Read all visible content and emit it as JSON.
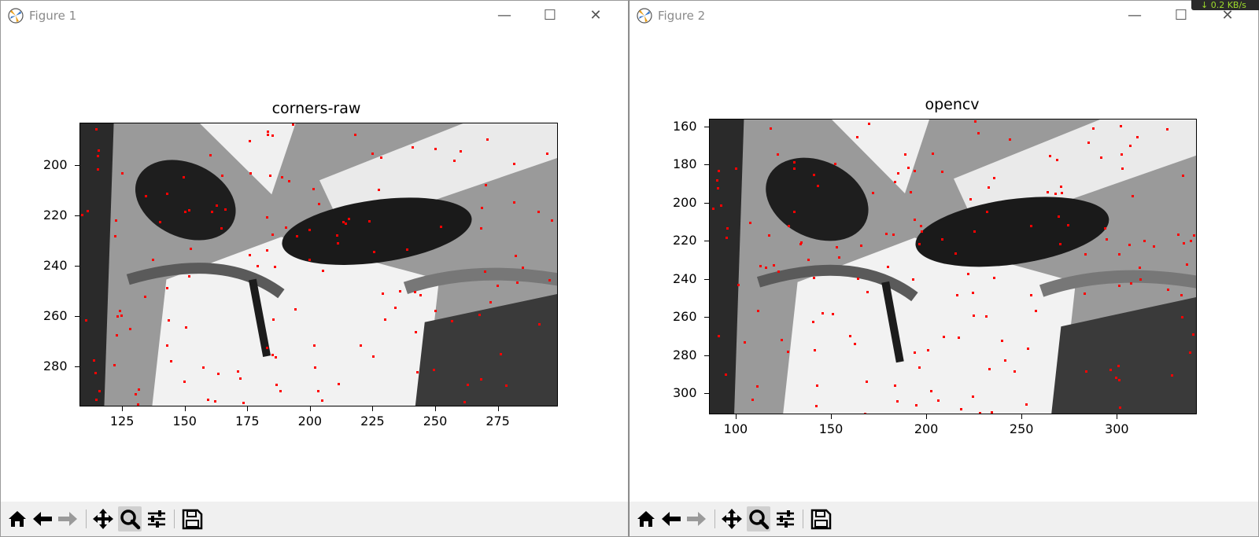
{
  "windows": [
    {
      "title": "Figure 1",
      "controls": {
        "minimize": "—",
        "maximize": "☐",
        "close": "✕"
      },
      "figure": {
        "title": "corners-raw",
        "chart_data": {
          "type": "heatmap",
          "title": "corners-raw",
          "x_ticks": [
            "125",
            "150",
            "175",
            "200",
            "225",
            "250",
            "275"
          ],
          "x_tick_values": [
            125,
            150,
            175,
            200,
            225,
            250,
            275
          ],
          "y_ticks": [
            "200",
            "220",
            "240",
            "260",
            "280"
          ],
          "y_tick_values": [
            200,
            220,
            240,
            260,
            280
          ],
          "xlim": [
            108,
            299
          ],
          "ylim": [
            296,
            183
          ],
          "image_content": "grayscale face/mask crop with red corner detection points"
        }
      }
    },
    {
      "title": "Figure 2",
      "controls": {
        "minimize": "—",
        "maximize": "☐",
        "close": "✕"
      },
      "figure": {
        "title": "opencv",
        "chart_data": {
          "type": "heatmap",
          "title": "opencv",
          "x_ticks": [
            "100",
            "150",
            "200",
            "250",
            "300"
          ],
          "x_tick_values": [
            100,
            150,
            200,
            250,
            300
          ],
          "y_ticks": [
            "160",
            "180",
            "200",
            "220",
            "240",
            "260",
            "280",
            "300"
          ],
          "y_tick_values": [
            160,
            180,
            200,
            220,
            240,
            260,
            280,
            300
          ],
          "xlim": [
            86,
            342
          ],
          "ylim": [
            311,
            156
          ],
          "image_content": "grayscale face/mask crop with red corner detection points"
        }
      }
    }
  ],
  "toolbar": {
    "buttons": [
      {
        "name": "home",
        "icon": "home-icon"
      },
      {
        "name": "back",
        "icon": "back-arrow-icon"
      },
      {
        "name": "forward",
        "icon": "forward-arrow-icon"
      },
      {
        "name": "pan",
        "icon": "move-icon"
      },
      {
        "name": "zoom",
        "icon": "magnifier-icon",
        "active": true
      },
      {
        "name": "configure",
        "icon": "sliders-icon"
      },
      {
        "name": "save",
        "icon": "floppy-icon"
      }
    ]
  },
  "network_indicator": "↓ 0.2 KB/s",
  "colors": {
    "corner_marker": "#ff0000",
    "toolbar_bg": "#f0f0f0",
    "active_tool": "#cfcfcf"
  }
}
